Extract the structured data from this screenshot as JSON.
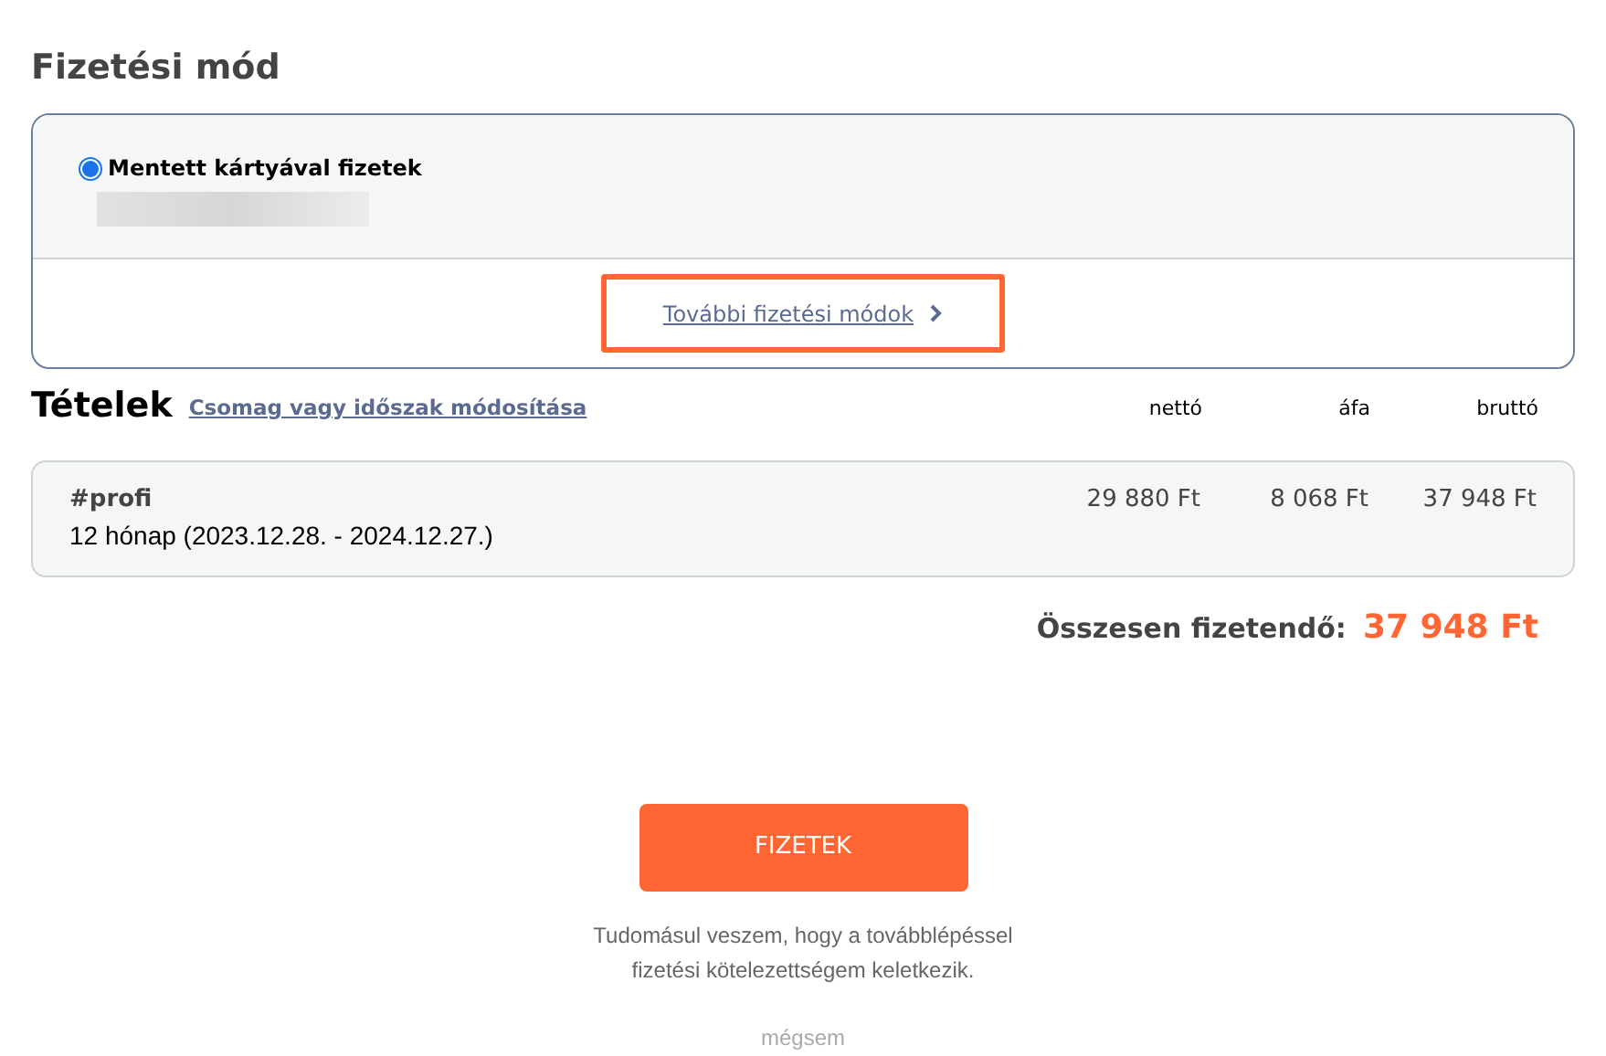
{
  "title": "Fizetési mód",
  "payment_options": [
    {
      "label": "Mentett kártyával fizetek",
      "selected": true
    }
  ],
  "more_methods_link": "További fizetési módok",
  "items_section": {
    "title": "Tételek",
    "change_link": "Csomag vagy időszak módosítása",
    "columns": [
      "nettó",
      "áfa",
      "bruttó"
    ]
  },
  "items": [
    {
      "name": "#profi",
      "period": "12 hónap (2023.12.28. - 2024.12.27.)",
      "net": "29 880 Ft",
      "vat": "8 068 Ft",
      "gross": "37 948 Ft"
    }
  ],
  "total": {
    "label": "Összesen fizetendő:",
    "value": "37 948 Ft"
  },
  "pay_button": "FIZETEK",
  "notice": "Tudomásul veszem, hogy a továbblépéssel fizetési kötelezettségem keletkezik.",
  "cancel_link": "mégsem"
}
